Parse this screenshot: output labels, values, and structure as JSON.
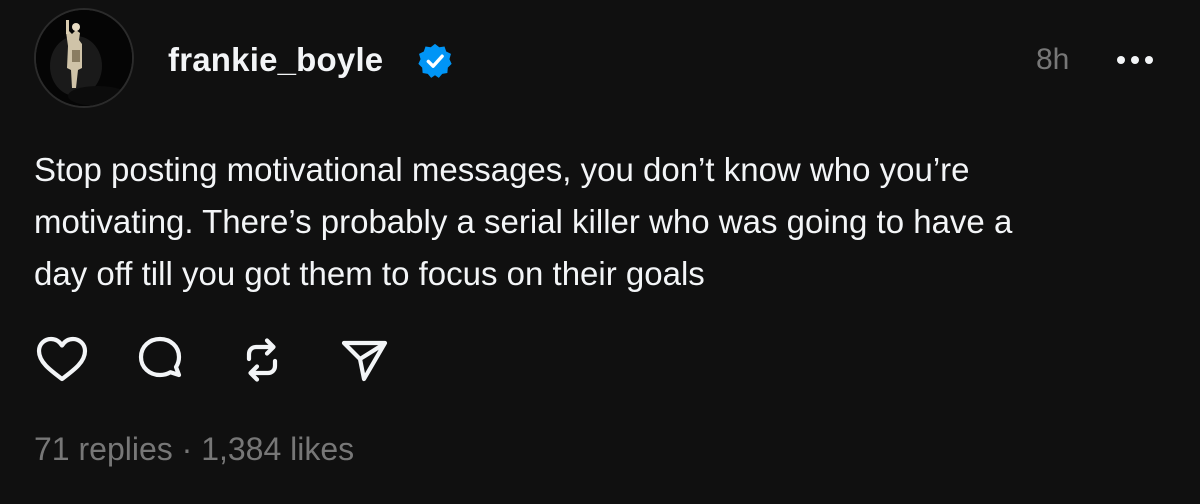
{
  "post": {
    "author": {
      "username": "frankie_boyle",
      "verified": true,
      "avatar_icon": "profile-photo-performer-on-stage"
    },
    "timestamp": "8h",
    "text": "Stop posting motivational messages, you don’t know who you’re\nmotivating. There’s probably a serial killer who was going to have a\nday off till you got them to focus on their goals",
    "actions": [
      {
        "name": "like",
        "icon": "heart-icon"
      },
      {
        "name": "reply",
        "icon": "speech-bubble-icon"
      },
      {
        "name": "repost",
        "icon": "repost-arrows-icon"
      },
      {
        "name": "share",
        "icon": "paper-plane-icon"
      }
    ],
    "stats": {
      "replies": "71 replies",
      "separator": "·",
      "likes": "1,384 likes"
    }
  },
  "colors": {
    "background": "#101010",
    "primary_text": "#f3f5f7",
    "secondary_text": "#777777",
    "verified_badge": "#0095f6"
  }
}
